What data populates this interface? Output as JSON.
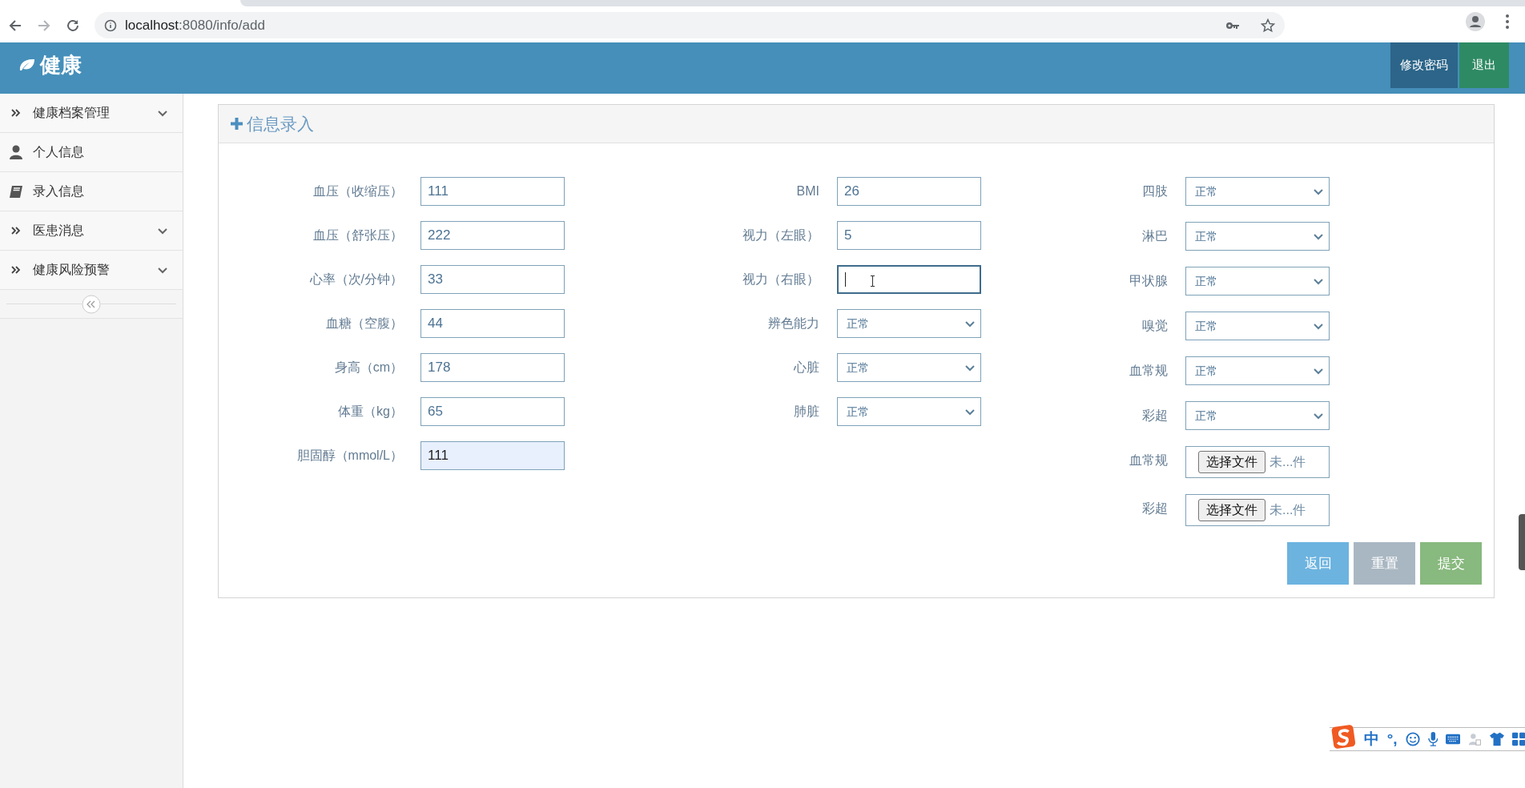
{
  "browser": {
    "url_host": "localhost",
    "url_rest": ":8080/info/add"
  },
  "header": {
    "brand": "健康",
    "buttons": [
      {
        "label": "修改密码",
        "kind": "password"
      },
      {
        "label": "退出",
        "kind": "logout"
      }
    ]
  },
  "sidebar": {
    "items": [
      {
        "label": "健康档案管理",
        "kind": "group"
      },
      {
        "label": "个人信息",
        "kind": "person"
      },
      {
        "label": "录入信息",
        "kind": "book"
      },
      {
        "label": "医患消息",
        "kind": "group"
      },
      {
        "label": "健康风险预警",
        "kind": "group"
      }
    ]
  },
  "panel": {
    "title": "信息录入",
    "columns": [
      [
        {
          "label": "血压（收缩压）",
          "kind": "text",
          "value": "111",
          "focused": false,
          "autofilled": false
        },
        {
          "label": "血压（舒张压）",
          "kind": "text",
          "value": "222",
          "focused": false,
          "autofilled": false
        },
        {
          "label": "心率（次/分钟）",
          "kind": "text",
          "value": "33",
          "focused": false,
          "autofilled": false
        },
        {
          "label": "血糖（空腹）",
          "kind": "text",
          "value": "44",
          "focused": false,
          "autofilled": false
        },
        {
          "label": "身高（cm）",
          "kind": "text",
          "value": "178",
          "focused": false,
          "autofilled": false
        },
        {
          "label": "体重（kg）",
          "kind": "text",
          "value": "65",
          "focused": false,
          "autofilled": false
        },
        {
          "label": "胆固醇（mmol/L）",
          "kind": "text",
          "value": "111",
          "focused": false,
          "autofilled": true
        }
      ],
      [
        {
          "label": "BMI",
          "kind": "text",
          "value": "26",
          "focused": false,
          "autofilled": false
        },
        {
          "label": "视力（左眼）",
          "kind": "text",
          "value": "5",
          "focused": false,
          "autofilled": false
        },
        {
          "label": "视力（右眼）",
          "kind": "text",
          "focused": true,
          "autofilled": false
        },
        {
          "label": "辨色能力",
          "kind": "select",
          "value": "正常"
        },
        {
          "label": "心脏",
          "kind": "select",
          "value": "正常"
        },
        {
          "label": "肺脏",
          "kind": "select",
          "value": "正常"
        }
      ],
      [
        {
          "label": "四肢",
          "kind": "select",
          "value": "正常"
        },
        {
          "label": "淋巴",
          "kind": "select",
          "value": "正常"
        },
        {
          "label": "甲状腺",
          "kind": "select",
          "value": "正常"
        },
        {
          "label": "嗅觉",
          "kind": "select",
          "value": "正常"
        },
        {
          "label": "血常规",
          "kind": "select",
          "value": "正常"
        },
        {
          "label": "彩超",
          "kind": "select",
          "value": "正常"
        },
        {
          "label": "血常规",
          "kind": "file",
          "button": "选择文件",
          "status": "未...件"
        },
        {
          "label": "彩超",
          "kind": "file",
          "button": "选择文件",
          "status": "未...件"
        }
      ]
    ],
    "buttons": [
      {
        "label": "返回",
        "kind": "back"
      },
      {
        "label": "重置",
        "kind": "reset"
      },
      {
        "label": "提交",
        "kind": "submit"
      }
    ]
  },
  "ime_bar": {
    "mode": "中",
    "punctuation": "°,"
  }
}
